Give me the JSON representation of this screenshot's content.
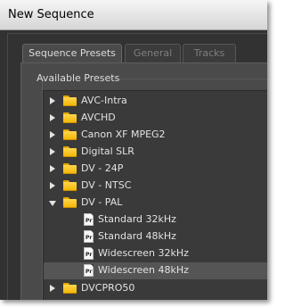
{
  "window": {
    "title": "New Sequence"
  },
  "tabs": [
    {
      "label": "Sequence Presets",
      "active": true
    },
    {
      "label": "General",
      "active": false
    },
    {
      "label": "Tracks",
      "active": false
    }
  ],
  "presets": {
    "heading": "Available Presets",
    "items": [
      {
        "label": "AVC-Intra",
        "type": "folder",
        "expanded": false
      },
      {
        "label": "AVCHD",
        "type": "folder",
        "expanded": false
      },
      {
        "label": "Canon XF MPEG2",
        "type": "folder",
        "expanded": false
      },
      {
        "label": "Digital SLR",
        "type": "folder",
        "expanded": false
      },
      {
        "label": "DV - 24P",
        "type": "folder",
        "expanded": false
      },
      {
        "label": "DV - NTSC",
        "type": "folder",
        "expanded": false
      },
      {
        "label": "DV - PAL",
        "type": "folder",
        "expanded": true
      },
      {
        "label": "Standard 32kHz",
        "type": "preset",
        "icon_text": "Pr"
      },
      {
        "label": "Standard 48kHz",
        "type": "preset",
        "icon_text": "Pr"
      },
      {
        "label": "Widescreen 32kHz",
        "type": "preset",
        "icon_text": "Pr"
      },
      {
        "label": "Widescreen 48kHz",
        "type": "preset",
        "icon_text": "Pr",
        "selected": true
      },
      {
        "label": "DVCPRO50",
        "type": "folder",
        "expanded": false
      }
    ]
  },
  "icons": {
    "folder": "folder-icon",
    "preset": "premiere-preset-file-icon",
    "collapsed": "triangle-right-icon",
    "expanded": "triangle-down-icon"
  },
  "colors": {
    "window_bg": "#333333",
    "panel_bg": "#4a4a4a",
    "tree_bg": "#3a3a3a",
    "selection": "#555555",
    "folder": "#f2b400",
    "text": "#e2e2e2"
  }
}
